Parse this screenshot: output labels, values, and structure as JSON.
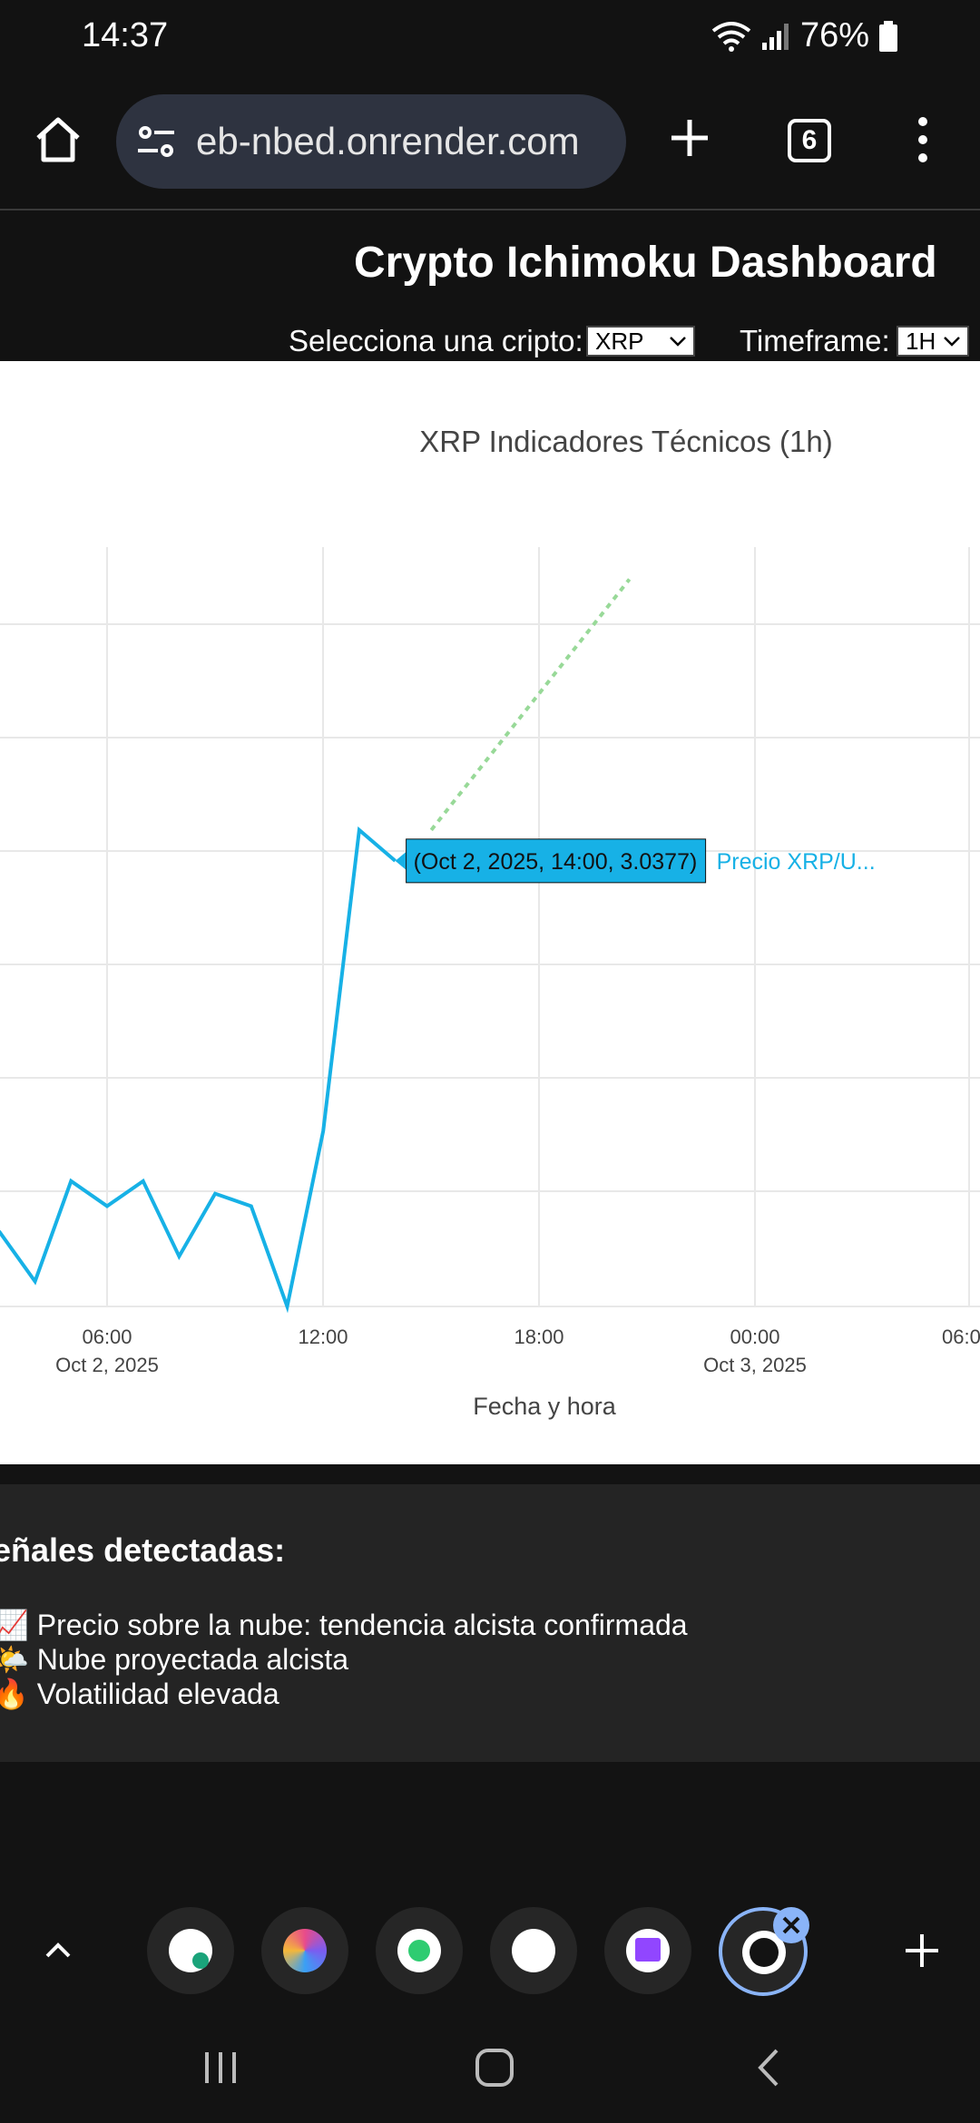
{
  "status_bar": {
    "time": "14:37",
    "battery": "76%"
  },
  "browser": {
    "url": "eb-nbed.onrender.com",
    "tab_count": "6"
  },
  "dashboard": {
    "title": "Crypto Ichimoku Dashboard",
    "crypto_label": "Selecciona una cripto:",
    "crypto_value": "XRP",
    "timeframe_label": "Timeframe:",
    "timeframe_value": "1H"
  },
  "chart_data": {
    "type": "line",
    "title": "XRP Indicadores Técnicos (1h)",
    "xlabel": "Fecha y hora",
    "x_ticks": [
      {
        "time": "06:00",
        "date": "Oct 2, 2025"
      },
      {
        "time": "12:00",
        "date": ""
      },
      {
        "time": "18:00",
        "date": ""
      },
      {
        "time": "00:00",
        "date": "Oct 3, 2025"
      },
      {
        "time": "06:0",
        "date": ""
      }
    ],
    "series": [
      {
        "name": "Precio XRP/U...",
        "color": "#17b1e6",
        "x": [
          "2025-10-02 03:00",
          "2025-10-02 04:00",
          "2025-10-02 05:00",
          "2025-10-02 06:00",
          "2025-10-02 07:00",
          "2025-10-02 08:00",
          "2025-10-02 09:00",
          "2025-10-02 10:00",
          "2025-10-02 11:00",
          "2025-10-02 12:00",
          "2025-10-02 13:00",
          "2025-10-02 14:00"
        ],
        "y": [
          2.89,
          2.87,
          2.91,
          2.9,
          2.91,
          2.88,
          2.905,
          2.9,
          2.86,
          2.93,
          3.05,
          3.0377
        ]
      },
      {
        "color": "#98d998",
        "dashed": true,
        "x": [
          "2025-10-02 15:00",
          "2025-10-02 20:30"
        ],
        "y": [
          3.05,
          3.15
        ]
      }
    ],
    "hover": {
      "text": "(Oct 2, 2025, 14:00, 3.0377)",
      "label": "Precio XRP/U..."
    },
    "grid": true
  },
  "signals": {
    "title": "eñales detectadas:",
    "items": [
      {
        "icon": "📈",
        "text": "Precio sobre la nube: tendencia alcista confirmada"
      },
      {
        "icon": "🌤️",
        "text": "Nube proyectada alcista"
      },
      {
        "icon": "🔥",
        "text": "Volatilidad elevada"
      }
    ]
  },
  "colors": {
    "accent": "#17b1e6",
    "projection": "#98d998",
    "panel_bg": "#242424"
  }
}
